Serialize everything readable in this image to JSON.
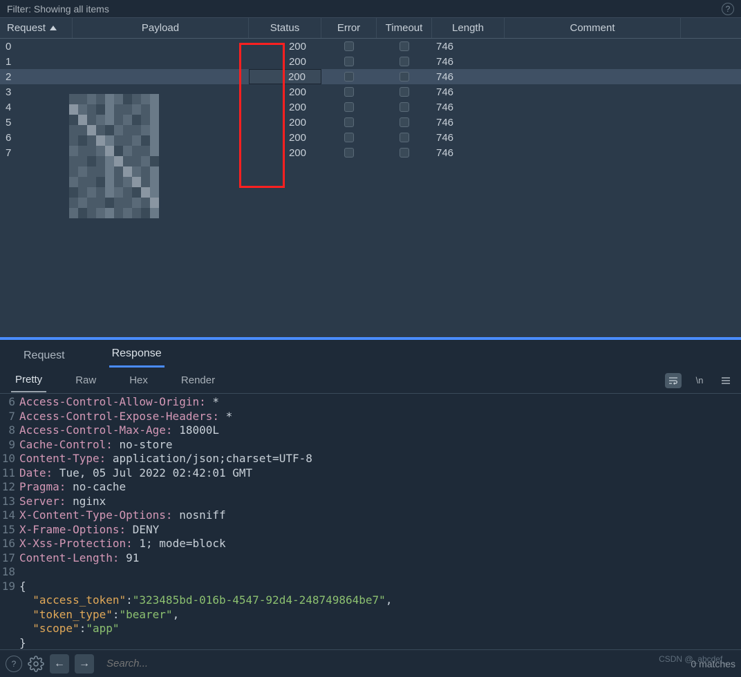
{
  "filter": {
    "text": "Filter: Showing all items"
  },
  "columns": {
    "request": "Request",
    "payload": "Payload",
    "status": "Status",
    "error": "Error",
    "timeout": "Timeout",
    "length": "Length",
    "comment": "Comment"
  },
  "rows": [
    {
      "request": "0",
      "status": "200",
      "length": "746",
      "selected": false
    },
    {
      "request": "1",
      "status": "200",
      "length": "746",
      "selected": false
    },
    {
      "request": "2",
      "status": "200",
      "length": "746",
      "selected": true
    },
    {
      "request": "3",
      "status": "200",
      "length": "746",
      "selected": false
    },
    {
      "request": "4",
      "status": "200",
      "length": "746",
      "selected": false
    },
    {
      "request": "5",
      "status": "200",
      "length": "746",
      "selected": false
    },
    {
      "request": "6",
      "status": "200",
      "length": "746",
      "selected": false
    },
    {
      "request": "7",
      "status": "200",
      "length": "746",
      "selected": false
    }
  ],
  "tabs1": {
    "request": "Request",
    "response": "Response",
    "active": "response"
  },
  "tabs2": {
    "pretty": "Pretty",
    "raw": "Raw",
    "hex": "Hex",
    "render": "Render",
    "newline": "\\n"
  },
  "search": {
    "placeholder": "Search...",
    "matches": "0 matches"
  },
  "watermark": "CSDN @_abcdef_",
  "code": [
    {
      "n": "6",
      "k": "Access-Control-Allow-Origin:",
      "v": " *"
    },
    {
      "n": "7",
      "k": "Access-Control-Expose-Headers:",
      "v": " *"
    },
    {
      "n": "8",
      "k": "Access-Control-Max-Age:",
      "v": " 18000L"
    },
    {
      "n": "9",
      "k": "Cache-Control:",
      "v": " no-store"
    },
    {
      "n": "10",
      "k": "Content-Type:",
      "v": " application/json;charset=UTF-8"
    },
    {
      "n": "11",
      "k": "Date:",
      "v": " Tue, 05 Jul 2022 02:42:01 GMT"
    },
    {
      "n": "12",
      "k": "Pragma:",
      "v": " no-cache"
    },
    {
      "n": "13",
      "k": "Server:",
      "v": " nginx"
    },
    {
      "n": "14",
      "k": "X-Content-Type-Options:",
      "v": " nosniff"
    },
    {
      "n": "15",
      "k": "X-Frame-Options:",
      "v": " DENY"
    },
    {
      "n": "16",
      "k": "X-Xss-Protection:",
      "v": " 1; mode=block"
    },
    {
      "n": "17",
      "k": "Content-Length:",
      "v": " 91"
    }
  ],
  "json_body": {
    "line_open": "19",
    "line_blank": "18",
    "brace_open": "{",
    "brace_close": "}",
    "entries": [
      {
        "key": "\"access_token\"",
        "val": "\"323485bd-016b-4547-92d4-248749864be7\"",
        "comma": ","
      },
      {
        "key": "\"token_type\"",
        "val": "\"bearer\"",
        "comma": ","
      },
      {
        "key": "\"scope\"",
        "val": "\"app\"",
        "comma": ""
      }
    ]
  }
}
